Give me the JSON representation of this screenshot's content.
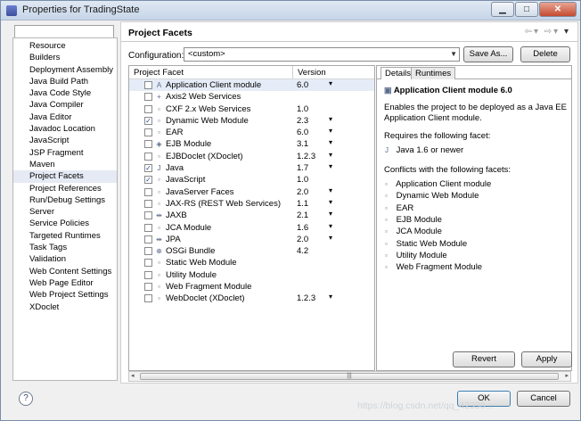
{
  "window": {
    "title": "Properties for TradingState"
  },
  "nav": {
    "filter_placeholder": "",
    "items": [
      {
        "label": "Resource"
      },
      {
        "label": "Builders"
      },
      {
        "label": "Deployment Assembly"
      },
      {
        "label": "Java Build Path"
      },
      {
        "label": "Java Code Style"
      },
      {
        "label": "Java Compiler"
      },
      {
        "label": "Java Editor"
      },
      {
        "label": "Javadoc Location"
      },
      {
        "label": "JavaScript"
      },
      {
        "label": "JSP Fragment"
      },
      {
        "label": "Maven"
      },
      {
        "label": "Project Facets",
        "selected": true
      },
      {
        "label": "Project References"
      },
      {
        "label": "Run/Debug Settings"
      },
      {
        "label": "Server"
      },
      {
        "label": "Service Policies"
      },
      {
        "label": "Targeted Runtimes"
      },
      {
        "label": "Task Tags"
      },
      {
        "label": "Validation"
      },
      {
        "label": "Web Content Settings"
      },
      {
        "label": "Web Page Editor"
      },
      {
        "label": "Web Project Settings"
      },
      {
        "label": "XDoclet"
      }
    ]
  },
  "page": {
    "title": "Project Facets",
    "configuration_label": "Configuration:",
    "configuration_value": "<custom>",
    "save_as_label": "Save As...",
    "delete_label": "Delete"
  },
  "facets": {
    "col_name": "Project Facet",
    "col_version": "Version",
    "rows": [
      {
        "name": "Application Client module",
        "version": "6.0",
        "checked": false,
        "dropdown": true,
        "selected": true,
        "icon": "A"
      },
      {
        "name": "Axis2 Web Services",
        "version": "",
        "checked": false,
        "dropdown": false,
        "icon": "+"
      },
      {
        "name": "CXF 2.x Web Services",
        "version": "1.0",
        "checked": false,
        "dropdown": false,
        "icon": "▫"
      },
      {
        "name": "Dynamic Web Module",
        "version": "2.3",
        "checked": true,
        "dropdown": true,
        "icon": "▫"
      },
      {
        "name": "EAR",
        "version": "6.0",
        "checked": false,
        "dropdown": true,
        "icon": "▫"
      },
      {
        "name": "EJB Module",
        "version": "3.1",
        "checked": false,
        "dropdown": true,
        "icon": "◈"
      },
      {
        "name": "EJBDoclet (XDoclet)",
        "version": "1.2.3",
        "checked": false,
        "dropdown": true,
        "icon": "▫"
      },
      {
        "name": "Java",
        "version": "1.7",
        "checked": true,
        "dropdown": true,
        "icon": "J"
      },
      {
        "name": "JavaScript",
        "version": "1.0",
        "checked": true,
        "dropdown": false,
        "icon": "▫"
      },
      {
        "name": "JavaServer Faces",
        "version": "2.0",
        "checked": false,
        "dropdown": true,
        "icon": "▫"
      },
      {
        "name": "JAX-RS (REST Web Services)",
        "version": "1.1",
        "checked": false,
        "dropdown": true,
        "icon": "▫"
      },
      {
        "name": "JAXB",
        "version": "2.1",
        "checked": false,
        "dropdown": true,
        "icon": "⇹"
      },
      {
        "name": "JCA Module",
        "version": "1.6",
        "checked": false,
        "dropdown": true,
        "icon": "▫"
      },
      {
        "name": "JPA",
        "version": "2.0",
        "checked": false,
        "dropdown": true,
        "icon": "⇹"
      },
      {
        "name": "OSGi Bundle",
        "version": "4.2",
        "checked": false,
        "dropdown": false,
        "icon": "⊕"
      },
      {
        "name": "Static Web Module",
        "version": "",
        "checked": false,
        "dropdown": false,
        "icon": "▫"
      },
      {
        "name": "Utility Module",
        "version": "",
        "checked": false,
        "dropdown": false,
        "icon": "▫"
      },
      {
        "name": "Web Fragment Module",
        "version": "",
        "checked": false,
        "dropdown": false,
        "icon": "▫"
      },
      {
        "name": "WebDoclet (XDoclet)",
        "version": "1.2.3",
        "checked": false,
        "dropdown": true,
        "icon": "▫"
      }
    ]
  },
  "details": {
    "tab_details": "Details",
    "tab_runtimes": "Runtimes",
    "title": "Application Client module 6.0",
    "description": "Enables the project to be deployed as a Java EE Application Client module.",
    "requires_label": "Requires the following facet:",
    "requires": [
      "Java 1.6 or newer"
    ],
    "conflicts_label": "Conflicts with the following facets:",
    "conflicts": [
      "Application Client module",
      "Dynamic Web Module",
      "EAR",
      "EJB Module",
      "JCA Module",
      "Static Web Module",
      "Utility Module",
      "Web Fragment Module"
    ]
  },
  "buttons": {
    "revert": "Revert",
    "apply": "Apply",
    "ok": "OK",
    "cancel": "Cancel"
  },
  "watermark": "https://blog.csdn.net/qq_42330..."
}
